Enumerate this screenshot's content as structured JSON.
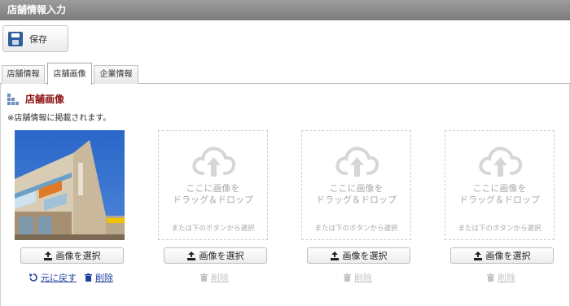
{
  "window": {
    "title": "店舗情報入力"
  },
  "toolbar": {
    "save_label": "保存"
  },
  "tabs": [
    {
      "label": "店舗情報",
      "active": false
    },
    {
      "label": "店舗画像",
      "active": true
    },
    {
      "label": "企業情報",
      "active": false
    }
  ],
  "section": {
    "title": "店舗画像",
    "note": "※店舗情報に掲載されます。"
  },
  "slots": [
    {
      "has_image": true,
      "select_label": "画像を選択",
      "revert_label": "元に戻す",
      "delete_label": "削除"
    },
    {
      "has_image": false,
      "drop_line1": "ここに画像を",
      "drop_line2": "ドラッグ＆ドロップ",
      "drop_sub": "または下のボタンから選択",
      "select_label": "画像を選択",
      "delete_label": "削除"
    },
    {
      "has_image": false,
      "drop_line1": "ここに画像を",
      "drop_line2": "ドラッグ＆ドロップ",
      "drop_sub": "または下のボタンから選択",
      "select_label": "画像を選択",
      "delete_label": "削除"
    },
    {
      "has_image": false,
      "drop_line1": "ここに画像を",
      "drop_line2": "ドラッグ＆ドロップ",
      "drop_sub": "または下のボタンから選択",
      "select_label": "画像を選択",
      "delete_label": "削除"
    }
  ],
  "colors": {
    "titlebar": "#8a8a8a",
    "section_title": "#8b1010",
    "link": "#1f3fa0",
    "disabled": "#c4c4c4"
  }
}
